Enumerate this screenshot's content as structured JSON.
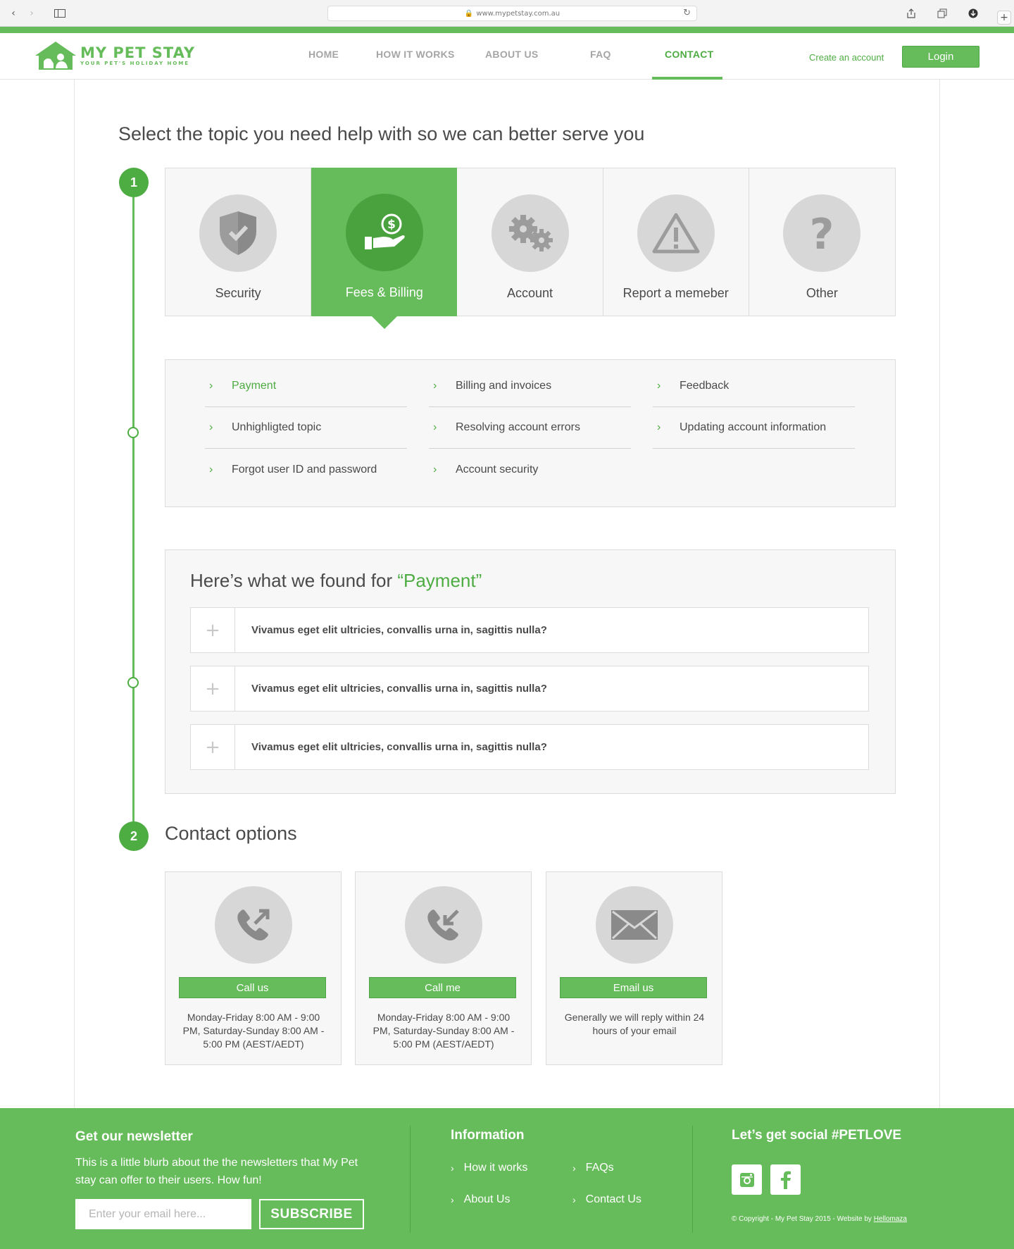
{
  "browser": {
    "url": "www.mypetstay.com.au"
  },
  "header": {
    "logo_name": "MY PET STAY",
    "logo_tagline": "YOUR PET'S HOLIDAY HOME",
    "nav": [
      "HOME",
      "HOW IT WORKS",
      "ABOUT US",
      "FAQ",
      "CONTACT"
    ],
    "active_nav": "CONTACT",
    "create_account": "Create an account",
    "login": "Login"
  },
  "step1": {
    "number": "1",
    "heading": "Select the topic you need help with so we can better serve you",
    "topics": [
      {
        "label": "Security",
        "icon": "shield-icon"
      },
      {
        "label": "Fees & Billing",
        "icon": "money-hand-icon",
        "active": true
      },
      {
        "label": "Account",
        "icon": "gears-icon"
      },
      {
        "label": "Report a memeber",
        "icon": "warning-icon"
      },
      {
        "label": "Other",
        "icon": "question-icon"
      }
    ],
    "subtopics": [
      [
        "Payment",
        "Billing  and invoices",
        "Feedback"
      ],
      [
        "Unhighligted topic",
        "Resolving account errors",
        "Updating account information"
      ],
      [
        "Forgot user ID and password",
        "Account security",
        ""
      ]
    ],
    "active_subtopic": "Payment"
  },
  "results": {
    "title_prefix": "Here’s what we found for ",
    "title_query": "“Payment”",
    "questions": [
      "Vivamus eget elit ultricies, convallis urna in, sagittis nulla?",
      "Vivamus eget elit ultricies, convallis urna in, sagittis nulla?",
      "Vivamus eget elit ultricies, convallis urna in, sagittis nulla?"
    ]
  },
  "step2": {
    "number": "2",
    "heading": "Contact options",
    "options": [
      {
        "button": "Call us",
        "icon": "phone-outgoing-icon",
        "desc": "Monday-Friday 8:00 AM - 9:00 PM, Saturday-Sunday 8:00 AM - 5:00 PM (AEST/AEDT)"
      },
      {
        "button": "Call me",
        "icon": "phone-incoming-icon",
        "desc": "Monday-Friday 8:00 AM - 9:00 PM, Saturday-Sunday 8:00 AM - 5:00 PM (AEST/AEDT)"
      },
      {
        "button": "Email us",
        "icon": "envelope-icon",
        "desc": "Generally we will reply within 24 hours of your email"
      }
    ]
  },
  "footer": {
    "newsletter_title": "Get our newsletter",
    "newsletter_blurb": "This is a little blurb about the the newsletters that My Pet stay can offer to their users. How fun!",
    "email_placeholder": "Enter your email here...",
    "subscribe": "SUBSCRIBE",
    "info_title": "Information",
    "links": [
      "How it works",
      "FAQs",
      "About Us",
      "Contact Us"
    ],
    "social_title": "Let’s get social #PETLOVE",
    "copyright_prefix": "© Copyright - My Pet Stay 2015 - Website by ",
    "copyright_link": "Hellomaza"
  },
  "colors": {
    "brand_green": "#66bb5a",
    "dark_green": "#4ead42",
    "icon_grey": "#d7d7d7"
  }
}
